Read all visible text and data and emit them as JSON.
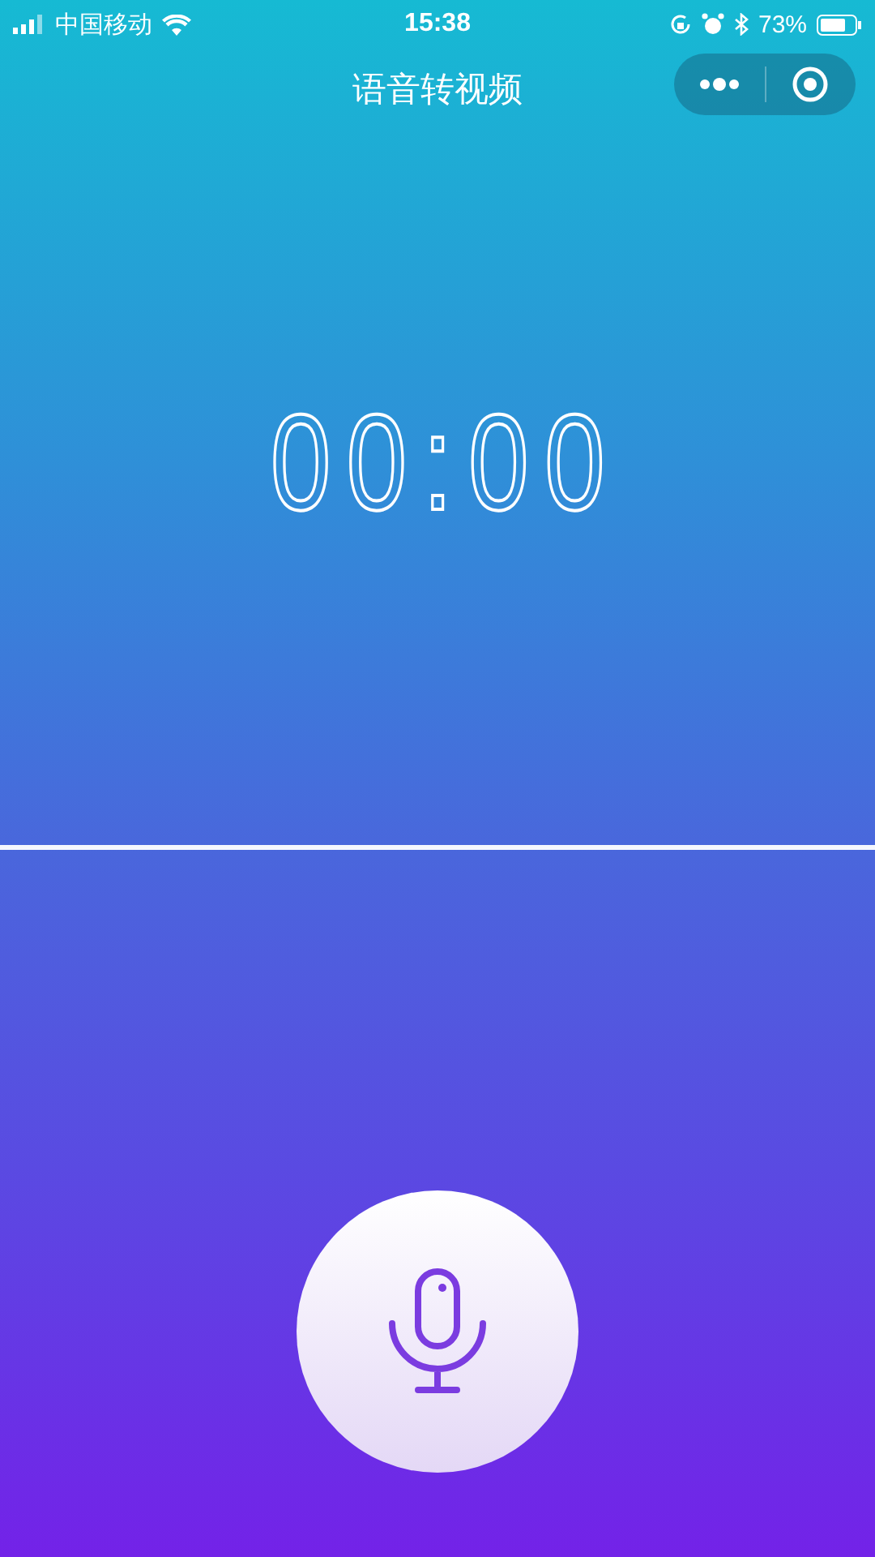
{
  "status_bar": {
    "carrier": "中国移动",
    "time": "15:38",
    "battery": "73%"
  },
  "nav_bar": {
    "title": "语音转视频"
  },
  "timer": "00:00"
}
